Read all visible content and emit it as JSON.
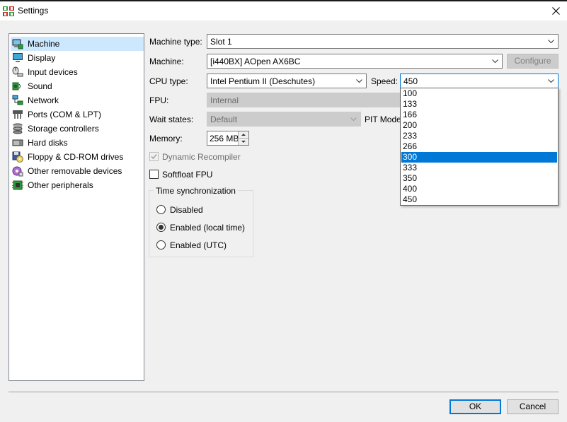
{
  "window": {
    "title": "Settings"
  },
  "sidebar": {
    "items": [
      {
        "label": "Machine",
        "icon": "machine-icon",
        "selected": true
      },
      {
        "label": "Display",
        "icon": "display-icon"
      },
      {
        "label": "Input devices",
        "icon": "input-devices-icon"
      },
      {
        "label": "Sound",
        "icon": "sound-icon"
      },
      {
        "label": "Network",
        "icon": "network-icon"
      },
      {
        "label": "Ports (COM & LPT)",
        "icon": "ports-icon"
      },
      {
        "label": "Storage controllers",
        "icon": "storage-controllers-icon"
      },
      {
        "label": "Hard disks",
        "icon": "hard-disk-icon"
      },
      {
        "label": "Floppy & CD-ROM drives",
        "icon": "floppy-cdrom-icon"
      },
      {
        "label": "Other removable devices",
        "icon": "removable-devices-icon"
      },
      {
        "label": "Other peripherals",
        "icon": "peripherals-icon"
      }
    ]
  },
  "machine": {
    "machine_type_label": "Machine type:",
    "machine_type_value": "Slot 1",
    "machine_label": "Machine:",
    "machine_value": "[i440BX] AOpen AX6BC",
    "configure_label": "Configure",
    "cpu_type_label": "CPU type:",
    "cpu_type_value": "Intel Pentium II (Deschutes)",
    "speed_label": "Speed:",
    "speed_value": "450",
    "fpu_label": "FPU:",
    "fpu_value": "Internal",
    "wait_states_label": "Wait states:",
    "wait_states_value": "Default",
    "pit_mode_label": "PIT Mode",
    "memory_label": "Memory:",
    "memory_value": "256 MB",
    "dynamic_recompiler_label": "Dynamic Recompiler",
    "dynamic_recompiler_checked": true,
    "softfloat_label": "Softfloat FPU",
    "softfloat_checked": false,
    "time_sync": {
      "title": "Time synchronization",
      "options": [
        {
          "label": "Disabled",
          "selected": false
        },
        {
          "label": "Enabled (local time)",
          "selected": true
        },
        {
          "label": "Enabled (UTC)",
          "selected": false
        }
      ]
    },
    "speed_options": [
      "100",
      "133",
      "166",
      "200",
      "233",
      "266",
      "300",
      "333",
      "350",
      "400",
      "450"
    ],
    "speed_highlighted": "300"
  },
  "buttons": {
    "ok": "OK",
    "cancel": "Cancel"
  },
  "colors": {
    "accent": "#0078d7",
    "selection": "#cce8ff"
  }
}
